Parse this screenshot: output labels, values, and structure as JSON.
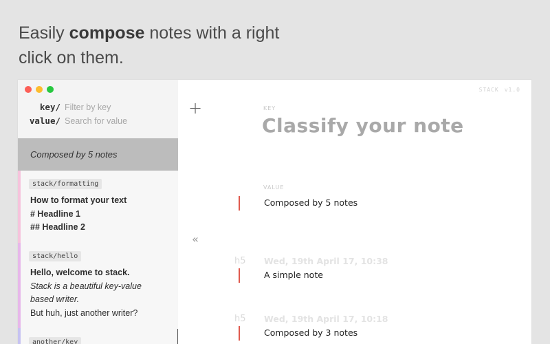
{
  "headline": {
    "before": "Easily ",
    "bold": "compose",
    "after": " notes with a right",
    "line2": "click on them."
  },
  "sidebar": {
    "key_label": "key/",
    "key_placeholder": "Filter by key",
    "value_label": "value/",
    "value_placeholder": "Search for value",
    "composed_label": "Composed by 5 notes",
    "notes": [
      {
        "tag": "stack/formatting",
        "lines": [
          "How to format your text",
          "# Headline 1",
          "## Headline 2"
        ],
        "stripe_color": "#f6c3dc"
      },
      {
        "tag": "stack/hello",
        "lines": [
          "Hello, welcome to stack.",
          "Stack is a beautiful key-value",
          "based writer.",
          "But huh, just another writer?"
        ],
        "stripe_color": "#e7b7ea"
      },
      {
        "tag": "another/key",
        "lines": [],
        "stripe_color": "#c6c2f2"
      }
    ]
  },
  "main": {
    "brand": "STACK",
    "version": "v1.0",
    "plus_icon": "plus-icon",
    "collapse_icon": "double-chevron-left-icon",
    "key_caption": "KEY",
    "title": "Classify your note",
    "value_caption": "VALUE",
    "value_text": "Composed by 5 notes",
    "entries": [
      {
        "heading": "h5",
        "date": "Wed, 19th April 17, 10:38",
        "text": "A simple note"
      },
      {
        "heading": "h5",
        "date": "Wed, 19th April 17, 10:18",
        "text": "Composed by 3 notes"
      }
    ],
    "accent_color": "#e05a4e"
  }
}
